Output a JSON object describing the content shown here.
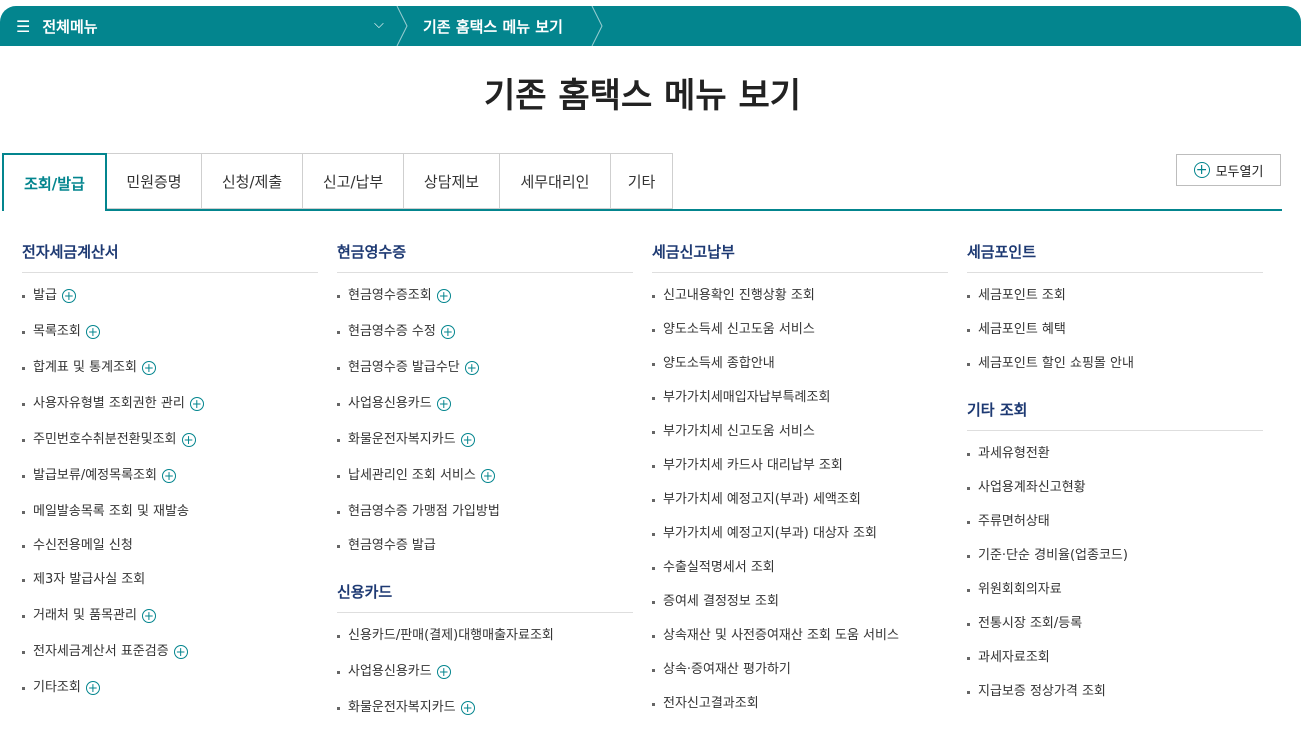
{
  "topbar": {
    "menu_all": "전체메뉴",
    "breadcrumb": "기존 홈택스 메뉴 보기"
  },
  "page_title": "기존 홈택스 메뉴 보기",
  "tabs": [
    "조회/발급",
    "민원증명",
    "신청/제출",
    "신고/납부",
    "상담제보",
    "세무대리인",
    "기타"
  ],
  "open_all": "모두열기",
  "columns": [
    {
      "sections": [
        {
          "title": "전자세금계산서",
          "items": [
            {
              "label": "발급",
              "expand": true
            },
            {
              "label": "목록조회",
              "expand": true
            },
            {
              "label": "합계표 및 통계조회",
              "expand": true
            },
            {
              "label": "사용자유형별 조회권한 관리",
              "expand": true
            },
            {
              "label": "주민번호수취분전환및조회",
              "expand": true
            },
            {
              "label": "발급보류/예정목록조회",
              "expand": true
            },
            {
              "label": "메일발송목록 조회 및 재발송",
              "expand": false
            },
            {
              "label": "수신전용메일 신청",
              "expand": false
            },
            {
              "label": "제3자 발급사실 조회",
              "expand": false
            },
            {
              "label": "거래처 및 품목관리",
              "expand": true
            },
            {
              "label": "전자세금계산서 표준검증",
              "expand": true
            },
            {
              "label": "기타조회",
              "expand": true
            }
          ]
        }
      ]
    },
    {
      "sections": [
        {
          "title": "현금영수증",
          "items": [
            {
              "label": "현금영수증조회",
              "expand": true
            },
            {
              "label": "현금영수증 수정",
              "expand": true
            },
            {
              "label": "현금영수증 발급수단",
              "expand": true
            },
            {
              "label": "사업용신용카드",
              "expand": true
            },
            {
              "label": "화물운전자복지카드",
              "expand": true
            },
            {
              "label": "납세관리인 조회 서비스",
              "expand": true
            },
            {
              "label": "현금영수증 가맹점 가입방법",
              "expand": false
            },
            {
              "label": "현금영수증 발급",
              "expand": false
            }
          ]
        },
        {
          "title": "신용카드",
          "items": [
            {
              "label": "신용카드/판매(결제)대행매출자료조회",
              "expand": false
            },
            {
              "label": "사업용신용카드",
              "expand": true
            },
            {
              "label": "화물운전자복지카드",
              "expand": true
            }
          ]
        }
      ]
    },
    {
      "sections": [
        {
          "title": "세금신고납부",
          "items": [
            {
              "label": "신고내용확인 진행상황 조회",
              "expand": false
            },
            {
              "label": "양도소득세 신고도움 서비스",
              "expand": false
            },
            {
              "label": "양도소득세 종합안내",
              "expand": false
            },
            {
              "label": "부가가치세매입자납부특례조회",
              "expand": false
            },
            {
              "label": "부가가치세 신고도움 서비스",
              "expand": false
            },
            {
              "label": "부가가치세 카드사 대리납부 조회",
              "expand": false
            },
            {
              "label": "부가가치세 예정고지(부과) 세액조회",
              "expand": false
            },
            {
              "label": "부가가치세 예정고지(부과) 대상자 조회",
              "expand": false
            },
            {
              "label": "수출실적명세서 조회",
              "expand": false
            },
            {
              "label": "증여세 결정정보 조회",
              "expand": false
            },
            {
              "label": "상속재산 및 사전증여재산 조회 도움 서비스",
              "expand": false
            },
            {
              "label": "상속·증여재산 평가하기",
              "expand": false
            },
            {
              "label": "전자신고결과조회",
              "expand": false
            }
          ]
        }
      ]
    },
    {
      "sections": [
        {
          "title": "세금포인트",
          "items": [
            {
              "label": "세금포인트 조회",
              "expand": false
            },
            {
              "label": "세금포인트 혜택",
              "expand": false
            },
            {
              "label": "세금포인트 할인 쇼핑몰 안내",
              "expand": false
            }
          ]
        },
        {
          "title": "기타 조회",
          "items": [
            {
              "label": "과세유형전환",
              "expand": false
            },
            {
              "label": "사업용계좌신고현황",
              "expand": false
            },
            {
              "label": "주류면허상태",
              "expand": false
            },
            {
              "label": "기준·단순 경비율(업종코드)",
              "expand": false
            },
            {
              "label": "위원회회의자료",
              "expand": false
            },
            {
              "label": "전통시장 조회/등록",
              "expand": false
            },
            {
              "label": "과세자료조회",
              "expand": false
            },
            {
              "label": "지급보증 정상가격 조회",
              "expand": false
            }
          ]
        }
      ]
    }
  ]
}
